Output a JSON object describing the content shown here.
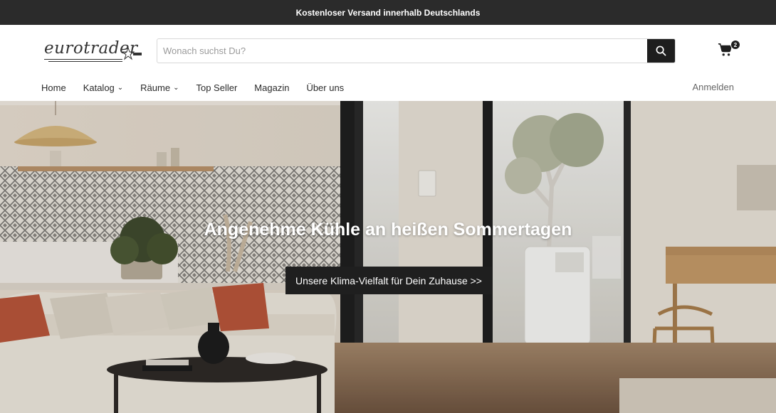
{
  "announcement": "Kostenloser Versand innerhalb Deutschlands",
  "logo": {
    "text": "eurotrader"
  },
  "search": {
    "placeholder": "Wonach suchst Du?",
    "value": ""
  },
  "cart": {
    "count": "2"
  },
  "nav": {
    "items": [
      {
        "label": "Home"
      },
      {
        "label": "Katalog"
      },
      {
        "label": "Räume"
      },
      {
        "label": "Top Seller"
      },
      {
        "label": "Magazin"
      },
      {
        "label": "Über uns"
      }
    ],
    "login": "Anmelden"
  },
  "hero": {
    "title": "Angenehme Kühle an heißen Sommertagen",
    "cta": "Unsere Klima-Vielfalt für Dein Zuhause >>"
  },
  "icons": {
    "search": "search-icon",
    "cart": "cart-icon",
    "chevron": "chevron-down-icon"
  },
  "colors": {
    "dark": "#2b2b2b",
    "button": "#1f1f1f",
    "accent_pillow": "#b8553a"
  }
}
